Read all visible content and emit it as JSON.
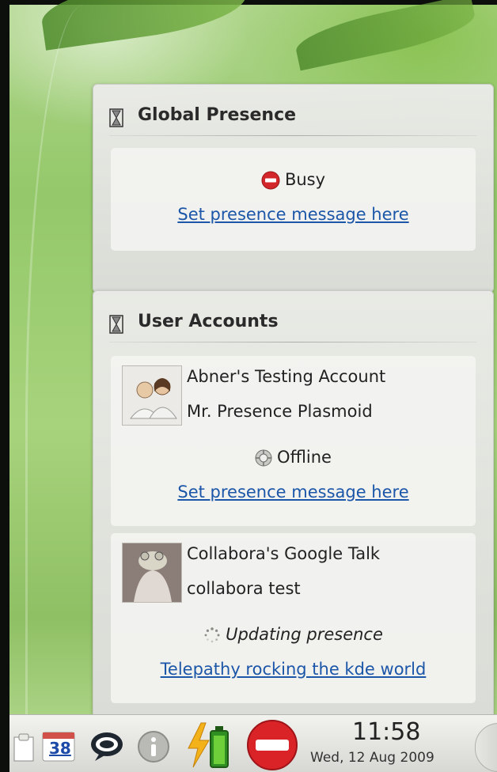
{
  "global_presence": {
    "title": "Global Presence",
    "status": "Busy",
    "message_link": "Set presence message here"
  },
  "user_accounts": {
    "title": "User Accounts",
    "accounts": [
      {
        "name": "Abner's Testing Account",
        "user": "Mr. Presence Plasmoid",
        "status": "Offline",
        "message": "Set presence message here"
      },
      {
        "name": "Collabora's Google Talk",
        "user": "collabora test",
        "status": "Updating presence",
        "message": "Telepathy rocking the kde world"
      }
    ]
  },
  "taskbar": {
    "calendar_day": "38",
    "time": "11:58",
    "date": "Wed, 12 Aug 2009"
  },
  "colors": {
    "link": "#1b56a8",
    "busy": "#d3262b",
    "panel_bg": "#e6e6e3",
    "desktop_green": "#9ccb72"
  },
  "icons": [
    "hourglass-icon",
    "busy-icon",
    "offline-icon",
    "updating-spinner-icon",
    "people-avatar",
    "frog-avatar",
    "clipboard-icon",
    "calendar-icon",
    "chat-icon",
    "info-icon",
    "battery-icon",
    "busy-presence-icon"
  ]
}
